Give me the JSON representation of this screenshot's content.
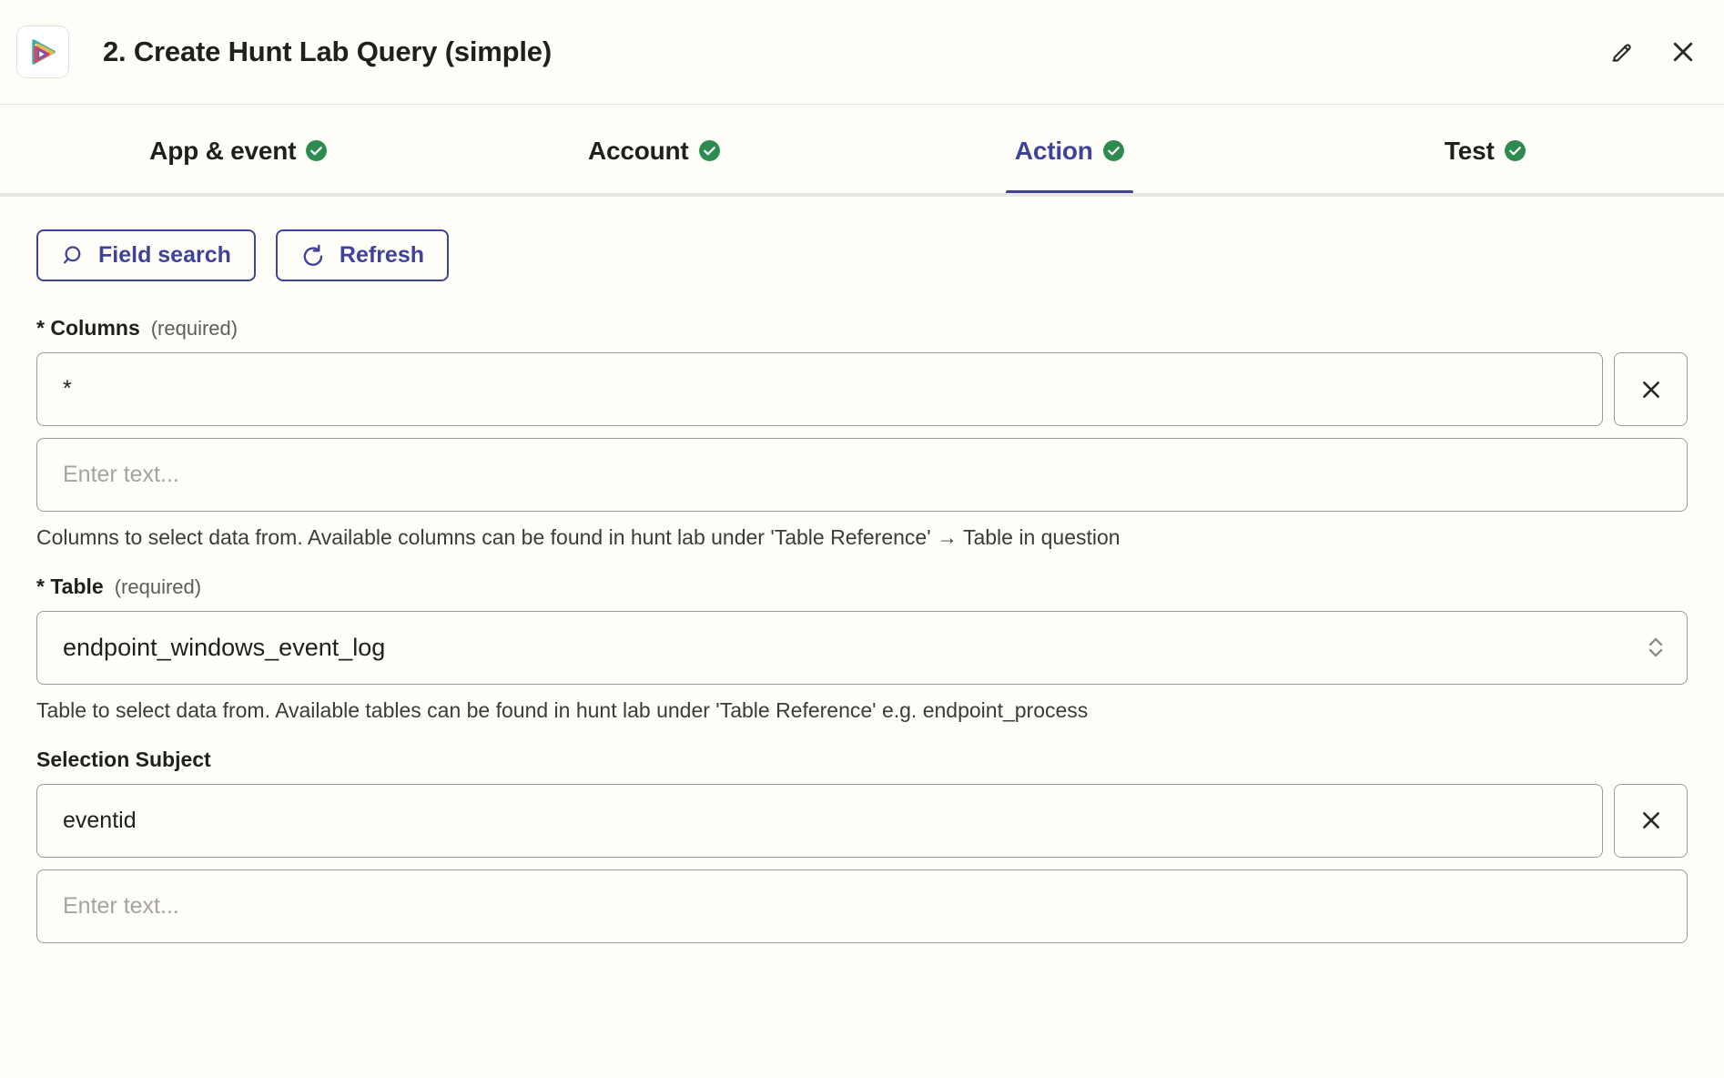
{
  "header": {
    "title": "2. Create Hunt Lab Query (simple)",
    "logo_icon": "penrose-triangle-play-logo",
    "edit_icon": "pencil-icon",
    "close_icon": "close-icon"
  },
  "tabs": [
    {
      "label": "App & event",
      "status_icon": "check-circle-icon",
      "active": false
    },
    {
      "label": "Account",
      "status_icon": "check-circle-icon",
      "active": false
    },
    {
      "label": "Action",
      "status_icon": "check-circle-icon",
      "active": true
    },
    {
      "label": "Test",
      "status_icon": "check-circle-icon",
      "active": false
    }
  ],
  "toolbar": {
    "field_search_label": "Field search",
    "field_search_icon": "search-icon",
    "refresh_label": "Refresh",
    "refresh_icon": "refresh-ccw-icon"
  },
  "fields": {
    "columns": {
      "label": "* Columns",
      "required_note": "(required)",
      "value": "*",
      "clear_icon": "close-icon",
      "extra_placeholder": "Enter text...",
      "helper": "Columns to select data from. Available columns can be found in hunt lab under 'Table Reference' → Table in question"
    },
    "table": {
      "label": "* Table",
      "required_note": "(required)",
      "value": "endpoint_windows_event_log",
      "chevron_icon": "chevron-up-down-icon",
      "helper": "Table to select data from. Available tables can be found in hunt lab under 'Table Reference' e.g. endpoint_process"
    },
    "selection_subject": {
      "label": "Selection Subject",
      "value": "eventid",
      "clear_icon": "close-icon",
      "extra_placeholder": "Enter text..."
    }
  },
  "colors": {
    "accent": "#3f4398",
    "success": "#2e8b4f",
    "page_bg": "#fffdf7",
    "border": "#9c9a94",
    "text": "#1f1f1f"
  }
}
